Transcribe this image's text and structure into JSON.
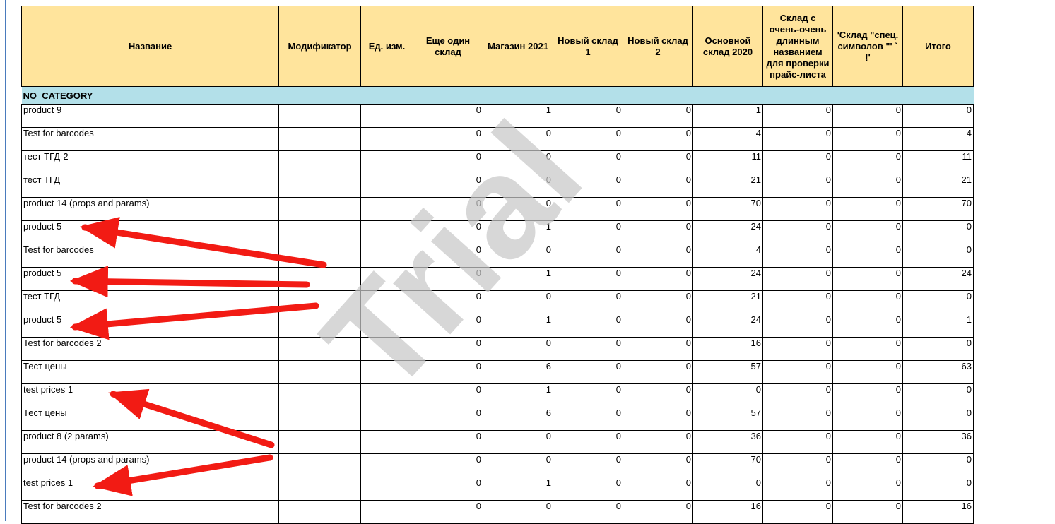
{
  "table": {
    "headers": [
      "Название",
      "Модификатор",
      "Ед. изм.",
      "Еще один склад",
      "Магазин 2021",
      "Новый склад 1",
      "Новый склад 2",
      "Основной склад 2020",
      "Склад с очень-очень длинным названием для проверки прайс-листа",
      "'Склад \"спец. символов \"' ` !'",
      "Итого"
    ],
    "category": "NO_CATEGORY",
    "rows": [
      {
        "name": "product 9",
        "vals": [
          "0",
          "1",
          "0",
          "0",
          "1",
          "0",
          "0",
          "0"
        ]
      },
      {
        "name": "Test for barcodes",
        "vals": [
          "0",
          "0",
          "0",
          "0",
          "4",
          "0",
          "0",
          "4"
        ]
      },
      {
        "name": "тест ТГД-2",
        "vals": [
          "0",
          "0",
          "0",
          "0",
          "11",
          "0",
          "0",
          "11"
        ]
      },
      {
        "name": "тест ТГД",
        "vals": [
          "0",
          "0",
          "0",
          "0",
          "21",
          "0",
          "0",
          "21"
        ]
      },
      {
        "name": "product 14 (props and params)",
        "vals": [
          "0",
          "0",
          "0",
          "0",
          "70",
          "0",
          "0",
          "70"
        ]
      },
      {
        "name": "product 5",
        "vals": [
          "0",
          "1",
          "0",
          "0",
          "24",
          "0",
          "0",
          "0"
        ]
      },
      {
        "name": "Test for barcodes",
        "vals": [
          "0",
          "0",
          "0",
          "0",
          "4",
          "0",
          "0",
          "0"
        ]
      },
      {
        "name": "product 5",
        "vals": [
          "0",
          "1",
          "0",
          "0",
          "24",
          "0",
          "0",
          "24"
        ]
      },
      {
        "name": "тест ТГД",
        "vals": [
          "0",
          "0",
          "0",
          "0",
          "21",
          "0",
          "0",
          "0"
        ]
      },
      {
        "name": "product 5",
        "vals": [
          "0",
          "1",
          "0",
          "0",
          "24",
          "0",
          "0",
          "1"
        ]
      },
      {
        "name": "Test for barcodes 2",
        "vals": [
          "0",
          "0",
          "0",
          "0",
          "16",
          "0",
          "0",
          "0"
        ]
      },
      {
        "name": "Тест цены",
        "vals": [
          "0",
          "6",
          "0",
          "0",
          "57",
          "0",
          "0",
          "63"
        ]
      },
      {
        "name": "test prices 1",
        "vals": [
          "0",
          "1",
          "0",
          "0",
          "0",
          "0",
          "0",
          "0"
        ]
      },
      {
        "name": "Тест цены",
        "vals": [
          "0",
          "6",
          "0",
          "0",
          "57",
          "0",
          "0",
          "0"
        ]
      },
      {
        "name": "product 8 (2 params)",
        "vals": [
          "0",
          "0",
          "0",
          "0",
          "36",
          "0",
          "0",
          "36"
        ]
      },
      {
        "name": "product 14 (props and params)",
        "vals": [
          "0",
          "0",
          "0",
          "0",
          "70",
          "0",
          "0",
          "0"
        ]
      },
      {
        "name": "test prices 1",
        "vals": [
          "0",
          "1",
          "0",
          "0",
          "0",
          "0",
          "0",
          "0"
        ]
      },
      {
        "name": "Test for barcodes 2",
        "vals": [
          "0",
          "0",
          "0",
          "0",
          "16",
          "0",
          "0",
          "16"
        ]
      }
    ]
  },
  "watermark": "Trial",
  "colors": {
    "header_bg": "#ffe49c",
    "category_bg": "#b3e0e9",
    "arrow": "#f21b14",
    "watermark": "#c9c9c9"
  }
}
